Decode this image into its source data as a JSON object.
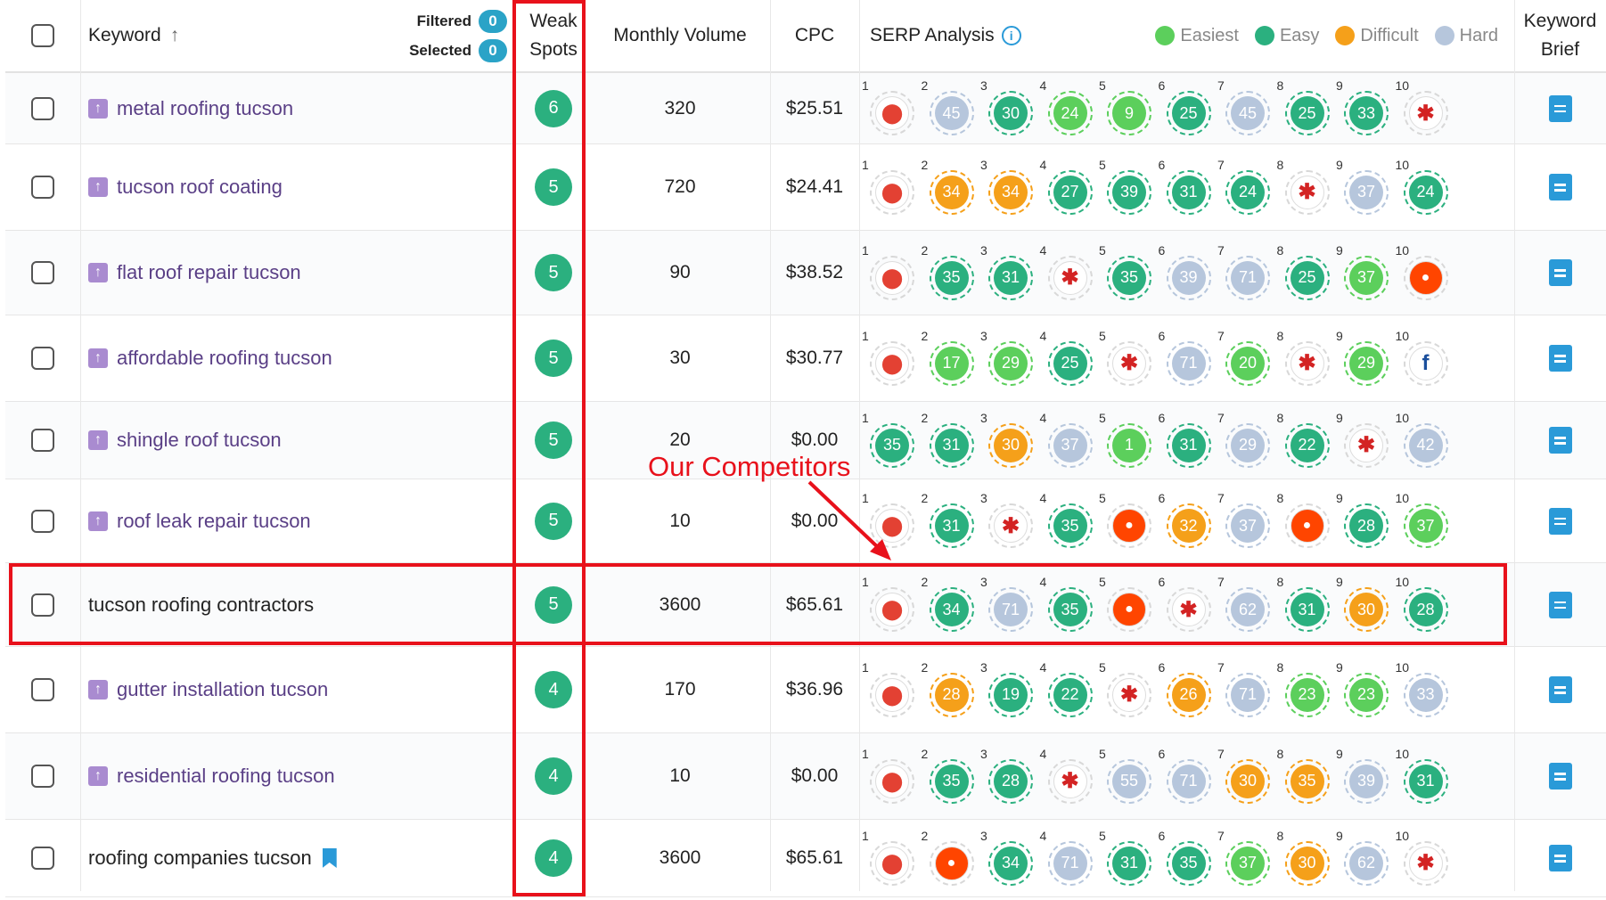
{
  "header": {
    "keyword": "Keyword",
    "sort_arrow": "↑",
    "filtered_label": "Filtered",
    "filtered_count": "0",
    "selected_label": "Selected",
    "selected_count": "0",
    "weak_spots_line1": "Weak",
    "weak_spots_line2": "Spots",
    "monthly_volume": "Monthly Volume",
    "cpc": "CPC",
    "serp_analysis": "SERP Analysis",
    "info": "i",
    "legend": [
      {
        "label": "Easiest",
        "color": "#5ccf5c"
      },
      {
        "label": "Easy",
        "color": "#2bb07f"
      },
      {
        "label": "Difficult",
        "color": "#f5a01a"
      },
      {
        "label": "Hard",
        "color": "#b6c6dc"
      }
    ],
    "keyword_brief_line1": "Keyword",
    "keyword_brief_line2": "Brief"
  },
  "annotation": {
    "text": "Our Competitors",
    "color": "#e8111b"
  },
  "rows": [
    {
      "keyword": "metal roofing tucson",
      "trend": true,
      "weak_spots": "6",
      "volume": "320",
      "cpc": "$25.51",
      "serp": [
        [
          "gmaps",
          "icon"
        ],
        [
          "45",
          "hard"
        ],
        [
          "30",
          "easy"
        ],
        [
          "24",
          "easiest"
        ],
        [
          "9",
          "easiest"
        ],
        [
          "25",
          "easy"
        ],
        [
          "45",
          "hard"
        ],
        [
          "25",
          "easy"
        ],
        [
          "33",
          "easy"
        ],
        [
          "yelp",
          "icon"
        ]
      ]
    },
    {
      "keyword": "tucson roof coating",
      "trend": true,
      "weak_spots": "5",
      "volume": "720",
      "cpc": "$24.41",
      "serp": [
        [
          "gmaps",
          "icon"
        ],
        [
          "34",
          "difficult"
        ],
        [
          "34",
          "difficult"
        ],
        [
          "27",
          "easy"
        ],
        [
          "39",
          "easy"
        ],
        [
          "31",
          "easy"
        ],
        [
          "24",
          "easy"
        ],
        [
          "yelp",
          "icon"
        ],
        [
          "37",
          "hard"
        ],
        [
          "24",
          "easy"
        ]
      ]
    },
    {
      "keyword": "flat roof repair tucson",
      "trend": true,
      "weak_spots": "5",
      "volume": "90",
      "cpc": "$38.52",
      "serp": [
        [
          "gmaps",
          "icon"
        ],
        [
          "35",
          "easy"
        ],
        [
          "31",
          "easy"
        ],
        [
          "yelp",
          "icon"
        ],
        [
          "35",
          "easy"
        ],
        [
          "39",
          "hard"
        ],
        [
          "71",
          "hard"
        ],
        [
          "25",
          "easy"
        ],
        [
          "37",
          "easiest"
        ],
        [
          "reddit",
          "icon"
        ]
      ]
    },
    {
      "keyword": "affordable roofing tucson",
      "trend": true,
      "weak_spots": "5",
      "volume": "30",
      "cpc": "$30.77",
      "serp": [
        [
          "gmaps",
          "icon"
        ],
        [
          "17",
          "easiest"
        ],
        [
          "29",
          "easiest"
        ],
        [
          "25",
          "easy"
        ],
        [
          "yelp",
          "icon"
        ],
        [
          "71",
          "hard"
        ],
        [
          "20",
          "easiest"
        ],
        [
          "yelp",
          "icon"
        ],
        [
          "29",
          "easiest"
        ],
        [
          "fb",
          "icon"
        ]
      ]
    },
    {
      "keyword": "shingle roof tucson",
      "trend": true,
      "weak_spots": "5",
      "volume": "20",
      "cpc": "$0.00",
      "serp": [
        [
          "35",
          "easy"
        ],
        [
          "31",
          "easy"
        ],
        [
          "30",
          "difficult"
        ],
        [
          "37",
          "hard"
        ],
        [
          "1",
          "easiest"
        ],
        [
          "31",
          "easy"
        ],
        [
          "29",
          "hard"
        ],
        [
          "22",
          "easy"
        ],
        [
          "yelp",
          "icon"
        ],
        [
          "42",
          "hard"
        ]
      ]
    },
    {
      "keyword": "roof leak repair tucson",
      "trend": true,
      "weak_spots": "5",
      "volume": "10",
      "cpc": "$0.00",
      "serp": [
        [
          "gmaps",
          "icon"
        ],
        [
          "31",
          "easy"
        ],
        [
          "yelp",
          "icon"
        ],
        [
          "35",
          "easy"
        ],
        [
          "reddit",
          "icon"
        ],
        [
          "32",
          "difficult"
        ],
        [
          "37",
          "hard"
        ],
        [
          "reddit",
          "icon"
        ],
        [
          "28",
          "easy"
        ],
        [
          "37",
          "easiest"
        ]
      ]
    },
    {
      "keyword": "tucson roofing contractors",
      "trend": false,
      "weak_spots": "5",
      "volume": "3600",
      "cpc": "$65.61",
      "serp": [
        [
          "gmaps",
          "icon"
        ],
        [
          "34",
          "easy"
        ],
        [
          "71",
          "hard"
        ],
        [
          "35",
          "easy"
        ],
        [
          "reddit",
          "icon"
        ],
        [
          "yelp",
          "icon"
        ],
        [
          "62",
          "hard"
        ],
        [
          "31",
          "easy"
        ],
        [
          "30",
          "difficult"
        ],
        [
          "28",
          "easy"
        ]
      ]
    },
    {
      "keyword": "gutter installation tucson",
      "trend": true,
      "weak_spots": "4",
      "volume": "170",
      "cpc": "$36.96",
      "serp": [
        [
          "gmaps",
          "icon"
        ],
        [
          "28",
          "difficult"
        ],
        [
          "19",
          "easy"
        ],
        [
          "22",
          "easy"
        ],
        [
          "yelp",
          "icon"
        ],
        [
          "26",
          "difficult"
        ],
        [
          "71",
          "hard"
        ],
        [
          "23",
          "easiest"
        ],
        [
          "23",
          "easiest"
        ],
        [
          "33",
          "hard"
        ]
      ]
    },
    {
      "keyword": "residential roofing tucson",
      "trend": true,
      "weak_spots": "4",
      "volume": "10",
      "cpc": "$0.00",
      "serp": [
        [
          "gmaps",
          "icon"
        ],
        [
          "35",
          "easy"
        ],
        [
          "28",
          "easy"
        ],
        [
          "yelp",
          "icon"
        ],
        [
          "55",
          "hard"
        ],
        [
          "71",
          "hard"
        ],
        [
          "30",
          "difficult"
        ],
        [
          "35",
          "difficult"
        ],
        [
          "39",
          "hard"
        ],
        [
          "31",
          "easy"
        ]
      ]
    },
    {
      "keyword": "roofing companies tucson",
      "trend": false,
      "bookmark": true,
      "weak_spots": "4",
      "volume": "3600",
      "cpc": "$65.61",
      "serp": [
        [
          "gmaps",
          "icon"
        ],
        [
          "reddit",
          "icon"
        ],
        [
          "34",
          "easy"
        ],
        [
          "71",
          "hard"
        ],
        [
          "31",
          "easy"
        ],
        [
          "35",
          "easy"
        ],
        [
          "37",
          "easiest"
        ],
        [
          "30",
          "difficult"
        ],
        [
          "62",
          "hard"
        ],
        [
          "yelp",
          "icon"
        ]
      ]
    }
  ]
}
